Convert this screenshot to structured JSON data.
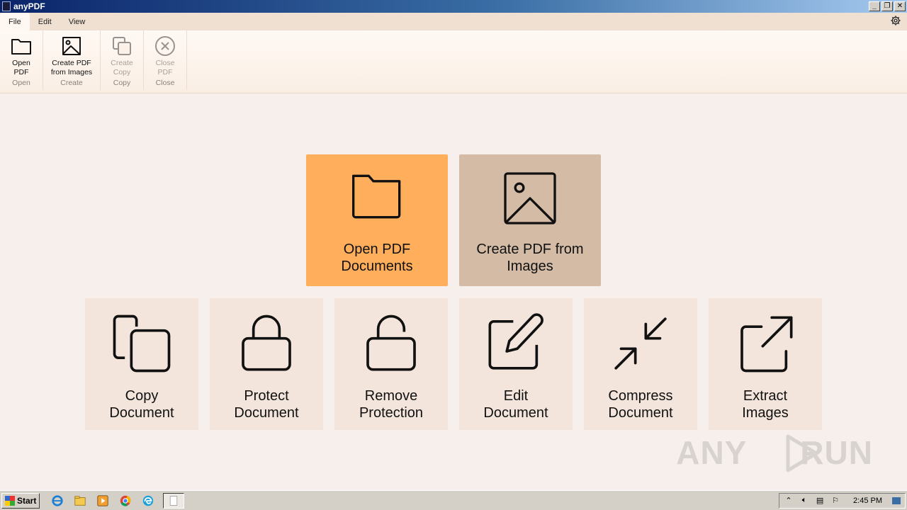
{
  "window": {
    "title": "anyPDF"
  },
  "menu": {
    "tabs": [
      "File",
      "Edit",
      "View"
    ],
    "active": "File"
  },
  "ribbon": {
    "groups": [
      {
        "name": "Open",
        "button": {
          "label": "Open\nPDF",
          "icon": "folder-icon",
          "enabled": true
        }
      },
      {
        "name": "Create",
        "button": {
          "label": "Create PDF\nfrom Images",
          "icon": "image-icon",
          "enabled": true
        }
      },
      {
        "name": "Copy",
        "button": {
          "label": "Create\nCopy",
          "icon": "copy-icon",
          "enabled": false
        }
      },
      {
        "name": "Close",
        "button": {
          "label": "Close\nPDF",
          "icon": "close-circle-icon",
          "enabled": false
        }
      }
    ]
  },
  "tiles": {
    "open": {
      "label": "Open PDF\nDocuments",
      "icon": "folder-icon",
      "color": "#ffae5c"
    },
    "create": {
      "label": "Create PDF from\nImages",
      "icon": "image-icon",
      "color": "#d3bba5"
    },
    "copy": {
      "label": "Copy\nDocument",
      "icon": "copy-icon"
    },
    "protect": {
      "label": "Protect\nDocument",
      "icon": "lock-icon"
    },
    "remove": {
      "label": "Remove\nProtection",
      "icon": "unlock-icon"
    },
    "edit": {
      "label": "Edit\nDocument",
      "icon": "edit-icon"
    },
    "compress": {
      "label": "Compress\nDocument",
      "icon": "compress-icon"
    },
    "extract": {
      "label": "Extract\nImages",
      "icon": "external-link-icon"
    }
  },
  "watermark": {
    "text": "ANY RUN"
  },
  "taskbar": {
    "start_label": "Start",
    "clock": "2:45 PM"
  }
}
